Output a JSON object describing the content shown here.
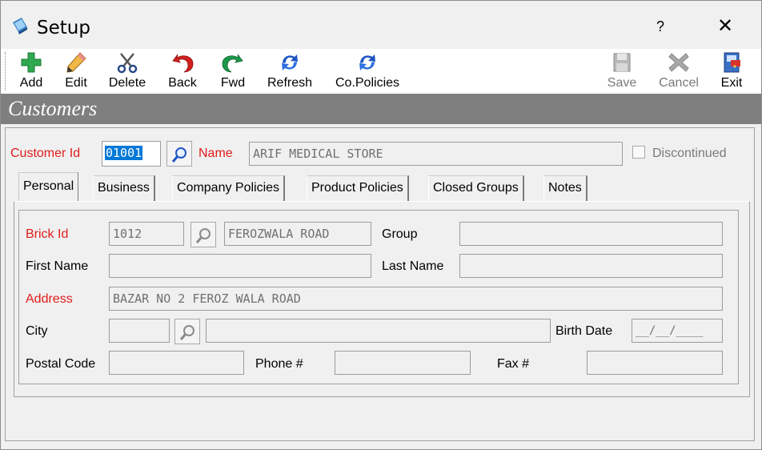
{
  "window": {
    "title": "Setup",
    "help": "?",
    "close": "✕"
  },
  "toolbar": {
    "add": "Add",
    "edit": "Edit",
    "delete": "Delete",
    "back": "Back",
    "fwd": "Fwd",
    "refresh": "Refresh",
    "co_policies": "Co.Policies",
    "save": "Save",
    "cancel": "Cancel",
    "exit": "Exit"
  },
  "section": {
    "title": "Customers"
  },
  "customer": {
    "id_label": "Customer Id",
    "id_value": "01001",
    "name_label": "Name",
    "name_value": "ARIF MEDICAL STORE",
    "discontinued_label": "Discontinued"
  },
  "tabs": [
    "Personal",
    "Business",
    "Company Policies",
    "Product Policies",
    "Closed Groups",
    "Notes"
  ],
  "personal": {
    "brick_id_label": "Brick Id",
    "brick_id_value": "1012",
    "brick_name_value": "FEROZWALA ROAD",
    "group_label": "Group",
    "group_value": "",
    "first_name_label": "First Name",
    "first_name_value": "",
    "last_name_label": "Last Name",
    "last_name_value": "",
    "address_label": "Address",
    "address_value": "BAZAR NO 2 FEROZ WALA ROAD",
    "city_label": "City",
    "city_code_value": "",
    "city_name_value": "",
    "birth_date_label": "Birth Date",
    "birth_date_value": "__/__/____",
    "postal_code_label": "Postal Code",
    "postal_code_value": "",
    "phone_label": "Phone #",
    "phone_value": "",
    "fax_label": "Fax #",
    "fax_value": ""
  },
  "colors": {
    "required_label": "#e21b1b",
    "section_bg": "#7f7f7f",
    "selection": "#0078d7"
  }
}
